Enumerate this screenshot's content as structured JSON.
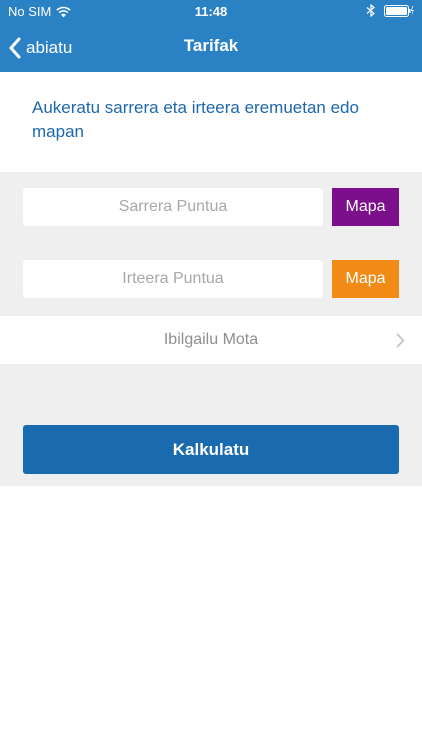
{
  "status_bar": {
    "carrier": "No SIM",
    "time": "11:48",
    "wifi_icon": "wifi-icon",
    "bluetooth_icon": "bluetooth-icon",
    "battery_icon": "battery-charging-icon"
  },
  "nav": {
    "back_label": "abiatu",
    "title": "Tarifak",
    "back_icon": "chevron-left-icon"
  },
  "instruction": {
    "text": "Aukeratu sarrera eta irteera eremuetan edo mapan"
  },
  "form": {
    "entry": {
      "value": "",
      "placeholder": "Sarrera Puntua",
      "map_label": "Mapa",
      "map_color": "#7b0f8c"
    },
    "exit": {
      "value": "",
      "placeholder": "Irteera Puntua",
      "map_label": "Mapa",
      "map_color": "#f28b16"
    },
    "vehicle": {
      "label": "Ibilgailu Mota",
      "icon": "chevron-right-icon"
    },
    "calculate_label": "Kalkulatu"
  },
  "colors": {
    "header": "#2a82c5",
    "accent_text": "#1d67ad",
    "primary_button": "#1a6aaf",
    "form_background": "#efefef"
  }
}
